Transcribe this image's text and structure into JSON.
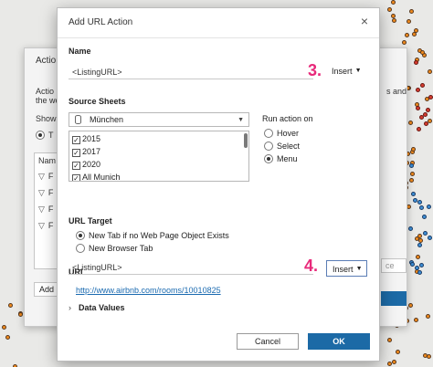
{
  "back_dialog": {
    "title": "Actio",
    "text_line1": "Actio",
    "text_line2": "the we",
    "show_label": "Show",
    "radio_fragment": "T",
    "column_header": "Nam",
    "rows": [
      "F",
      "F",
      "F",
      "F"
    ],
    "add_button": "Add",
    "right_text1": "s and",
    "right_text2": "ce"
  },
  "dialog": {
    "title": "Add URL Action",
    "name_label": "Name",
    "name_value": "<ListingURL>",
    "insert_label": "Insert",
    "step3": "3.",
    "source_sheets_label": "Source Sheets",
    "sheet_select": "München",
    "sheets": [
      "2015",
      "2017",
      "2020",
      "All Munich"
    ],
    "run_action_label": "Run action on",
    "run_options": [
      "Hover",
      "Select",
      "Menu"
    ],
    "run_selected": "Menu",
    "url_target_label": "URL Target",
    "url_targets": [
      "New Tab if no Web Page Object Exists",
      "New Browser Tab"
    ],
    "url_target_selected": "New Tab if no Web Page Object Exists",
    "url_label": "URL",
    "url_value": "<ListingURL>",
    "step4": "4.",
    "insert2_label": "Insert",
    "preview_link": "http://www.airbnb.com/rooms/10010825",
    "data_values_label": "Data Values",
    "cancel_label": "Cancel",
    "ok_label": "OK"
  }
}
